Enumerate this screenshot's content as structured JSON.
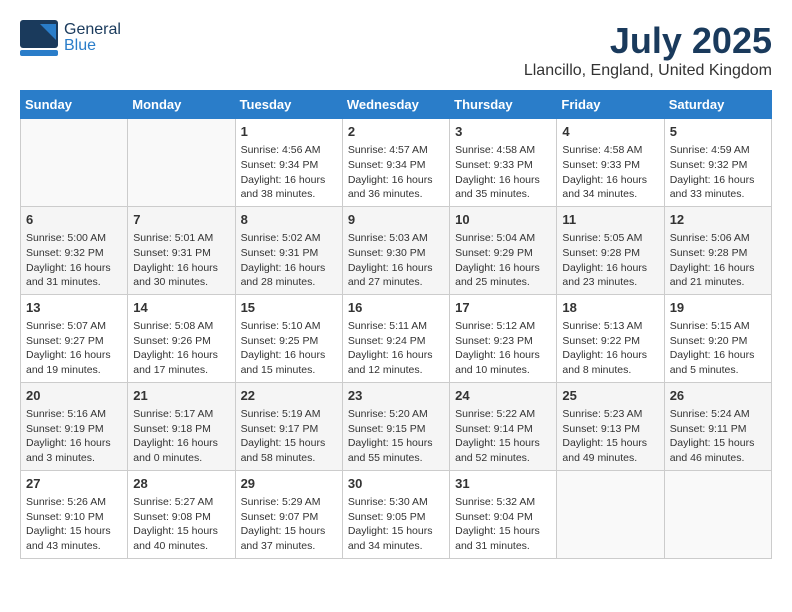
{
  "header": {
    "logo_general": "General",
    "logo_blue": "Blue",
    "title": "July 2025",
    "subtitle": "Llancillo, England, United Kingdom"
  },
  "weekdays": [
    "Sunday",
    "Monday",
    "Tuesday",
    "Wednesday",
    "Thursday",
    "Friday",
    "Saturday"
  ],
  "weeks": [
    [
      {
        "day": "",
        "content": ""
      },
      {
        "day": "",
        "content": ""
      },
      {
        "day": "1",
        "content": "Sunrise: 4:56 AM\nSunset: 9:34 PM\nDaylight: 16 hours and 38 minutes."
      },
      {
        "day": "2",
        "content": "Sunrise: 4:57 AM\nSunset: 9:34 PM\nDaylight: 16 hours and 36 minutes."
      },
      {
        "day": "3",
        "content": "Sunrise: 4:58 AM\nSunset: 9:33 PM\nDaylight: 16 hours and 35 minutes."
      },
      {
        "day": "4",
        "content": "Sunrise: 4:58 AM\nSunset: 9:33 PM\nDaylight: 16 hours and 34 minutes."
      },
      {
        "day": "5",
        "content": "Sunrise: 4:59 AM\nSunset: 9:32 PM\nDaylight: 16 hours and 33 minutes."
      }
    ],
    [
      {
        "day": "6",
        "content": "Sunrise: 5:00 AM\nSunset: 9:32 PM\nDaylight: 16 hours and 31 minutes."
      },
      {
        "day": "7",
        "content": "Sunrise: 5:01 AM\nSunset: 9:31 PM\nDaylight: 16 hours and 30 minutes."
      },
      {
        "day": "8",
        "content": "Sunrise: 5:02 AM\nSunset: 9:31 PM\nDaylight: 16 hours and 28 minutes."
      },
      {
        "day": "9",
        "content": "Sunrise: 5:03 AM\nSunset: 9:30 PM\nDaylight: 16 hours and 27 minutes."
      },
      {
        "day": "10",
        "content": "Sunrise: 5:04 AM\nSunset: 9:29 PM\nDaylight: 16 hours and 25 minutes."
      },
      {
        "day": "11",
        "content": "Sunrise: 5:05 AM\nSunset: 9:28 PM\nDaylight: 16 hours and 23 minutes."
      },
      {
        "day": "12",
        "content": "Sunrise: 5:06 AM\nSunset: 9:28 PM\nDaylight: 16 hours and 21 minutes."
      }
    ],
    [
      {
        "day": "13",
        "content": "Sunrise: 5:07 AM\nSunset: 9:27 PM\nDaylight: 16 hours and 19 minutes."
      },
      {
        "day": "14",
        "content": "Sunrise: 5:08 AM\nSunset: 9:26 PM\nDaylight: 16 hours and 17 minutes."
      },
      {
        "day": "15",
        "content": "Sunrise: 5:10 AM\nSunset: 9:25 PM\nDaylight: 16 hours and 15 minutes."
      },
      {
        "day": "16",
        "content": "Sunrise: 5:11 AM\nSunset: 9:24 PM\nDaylight: 16 hours and 12 minutes."
      },
      {
        "day": "17",
        "content": "Sunrise: 5:12 AM\nSunset: 9:23 PM\nDaylight: 16 hours and 10 minutes."
      },
      {
        "day": "18",
        "content": "Sunrise: 5:13 AM\nSunset: 9:22 PM\nDaylight: 16 hours and 8 minutes."
      },
      {
        "day": "19",
        "content": "Sunrise: 5:15 AM\nSunset: 9:20 PM\nDaylight: 16 hours and 5 minutes."
      }
    ],
    [
      {
        "day": "20",
        "content": "Sunrise: 5:16 AM\nSunset: 9:19 PM\nDaylight: 16 hours and 3 minutes."
      },
      {
        "day": "21",
        "content": "Sunrise: 5:17 AM\nSunset: 9:18 PM\nDaylight: 16 hours and 0 minutes."
      },
      {
        "day": "22",
        "content": "Sunrise: 5:19 AM\nSunset: 9:17 PM\nDaylight: 15 hours and 58 minutes."
      },
      {
        "day": "23",
        "content": "Sunrise: 5:20 AM\nSunset: 9:15 PM\nDaylight: 15 hours and 55 minutes."
      },
      {
        "day": "24",
        "content": "Sunrise: 5:22 AM\nSunset: 9:14 PM\nDaylight: 15 hours and 52 minutes."
      },
      {
        "day": "25",
        "content": "Sunrise: 5:23 AM\nSunset: 9:13 PM\nDaylight: 15 hours and 49 minutes."
      },
      {
        "day": "26",
        "content": "Sunrise: 5:24 AM\nSunset: 9:11 PM\nDaylight: 15 hours and 46 minutes."
      }
    ],
    [
      {
        "day": "27",
        "content": "Sunrise: 5:26 AM\nSunset: 9:10 PM\nDaylight: 15 hours and 43 minutes."
      },
      {
        "day": "28",
        "content": "Sunrise: 5:27 AM\nSunset: 9:08 PM\nDaylight: 15 hours and 40 minutes."
      },
      {
        "day": "29",
        "content": "Sunrise: 5:29 AM\nSunset: 9:07 PM\nDaylight: 15 hours and 37 minutes."
      },
      {
        "day": "30",
        "content": "Sunrise: 5:30 AM\nSunset: 9:05 PM\nDaylight: 15 hours and 34 minutes."
      },
      {
        "day": "31",
        "content": "Sunrise: 5:32 AM\nSunset: 9:04 PM\nDaylight: 15 hours and 31 minutes."
      },
      {
        "day": "",
        "content": ""
      },
      {
        "day": "",
        "content": ""
      }
    ]
  ]
}
